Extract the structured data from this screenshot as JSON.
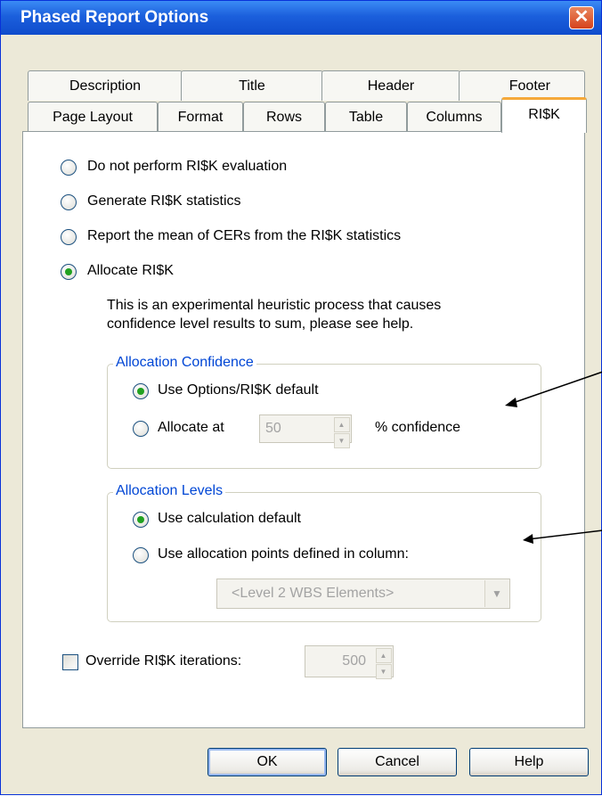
{
  "window": {
    "title": "Phased Report Options",
    "close_glyph": "✕"
  },
  "tabs": {
    "row1": [
      "Description",
      "Title",
      "Header",
      "Footer"
    ],
    "row2": [
      "Page Layout",
      "Format",
      "Rows",
      "Table",
      "Columns",
      "RI$K"
    ],
    "active": "RI$K"
  },
  "risk_options": [
    {
      "label": "Do not perform RI$K evaluation",
      "selected": false
    },
    {
      "label": "Generate RI$K statistics",
      "selected": false
    },
    {
      "label": "Report the mean of CERs from the RI$K statistics",
      "selected": false
    },
    {
      "label": "Allocate RI$K",
      "selected": true
    }
  ],
  "description_lines": [
    "This is an experimental heuristic process that causes",
    "confidence level results to sum, please see help."
  ],
  "allocation_confidence": {
    "legend": "Allocation Confidence",
    "use_default_label": "Use Options/RI$K default",
    "allocate_at_label": "Allocate at",
    "value": "50",
    "suffix": "% confidence",
    "selected": "use_default"
  },
  "allocation_levels": {
    "legend": "Allocation Levels",
    "use_calc_label": "Use calculation default",
    "use_points_label": "Use allocation points defined in column:",
    "column_value": "<Level 2 WBS Elements>",
    "selected": "use_calc"
  },
  "override": {
    "label": "Override RI$K iterations:",
    "checked": false,
    "value": "500"
  },
  "buttons": {
    "ok": "OK",
    "cancel": "Cancel",
    "help": "Help"
  },
  "colors": {
    "title_bar": "#1b5fdc",
    "legend": "#0046d5",
    "active_tab_accent": "#f5a93a",
    "radio_dot": "#21a121"
  }
}
